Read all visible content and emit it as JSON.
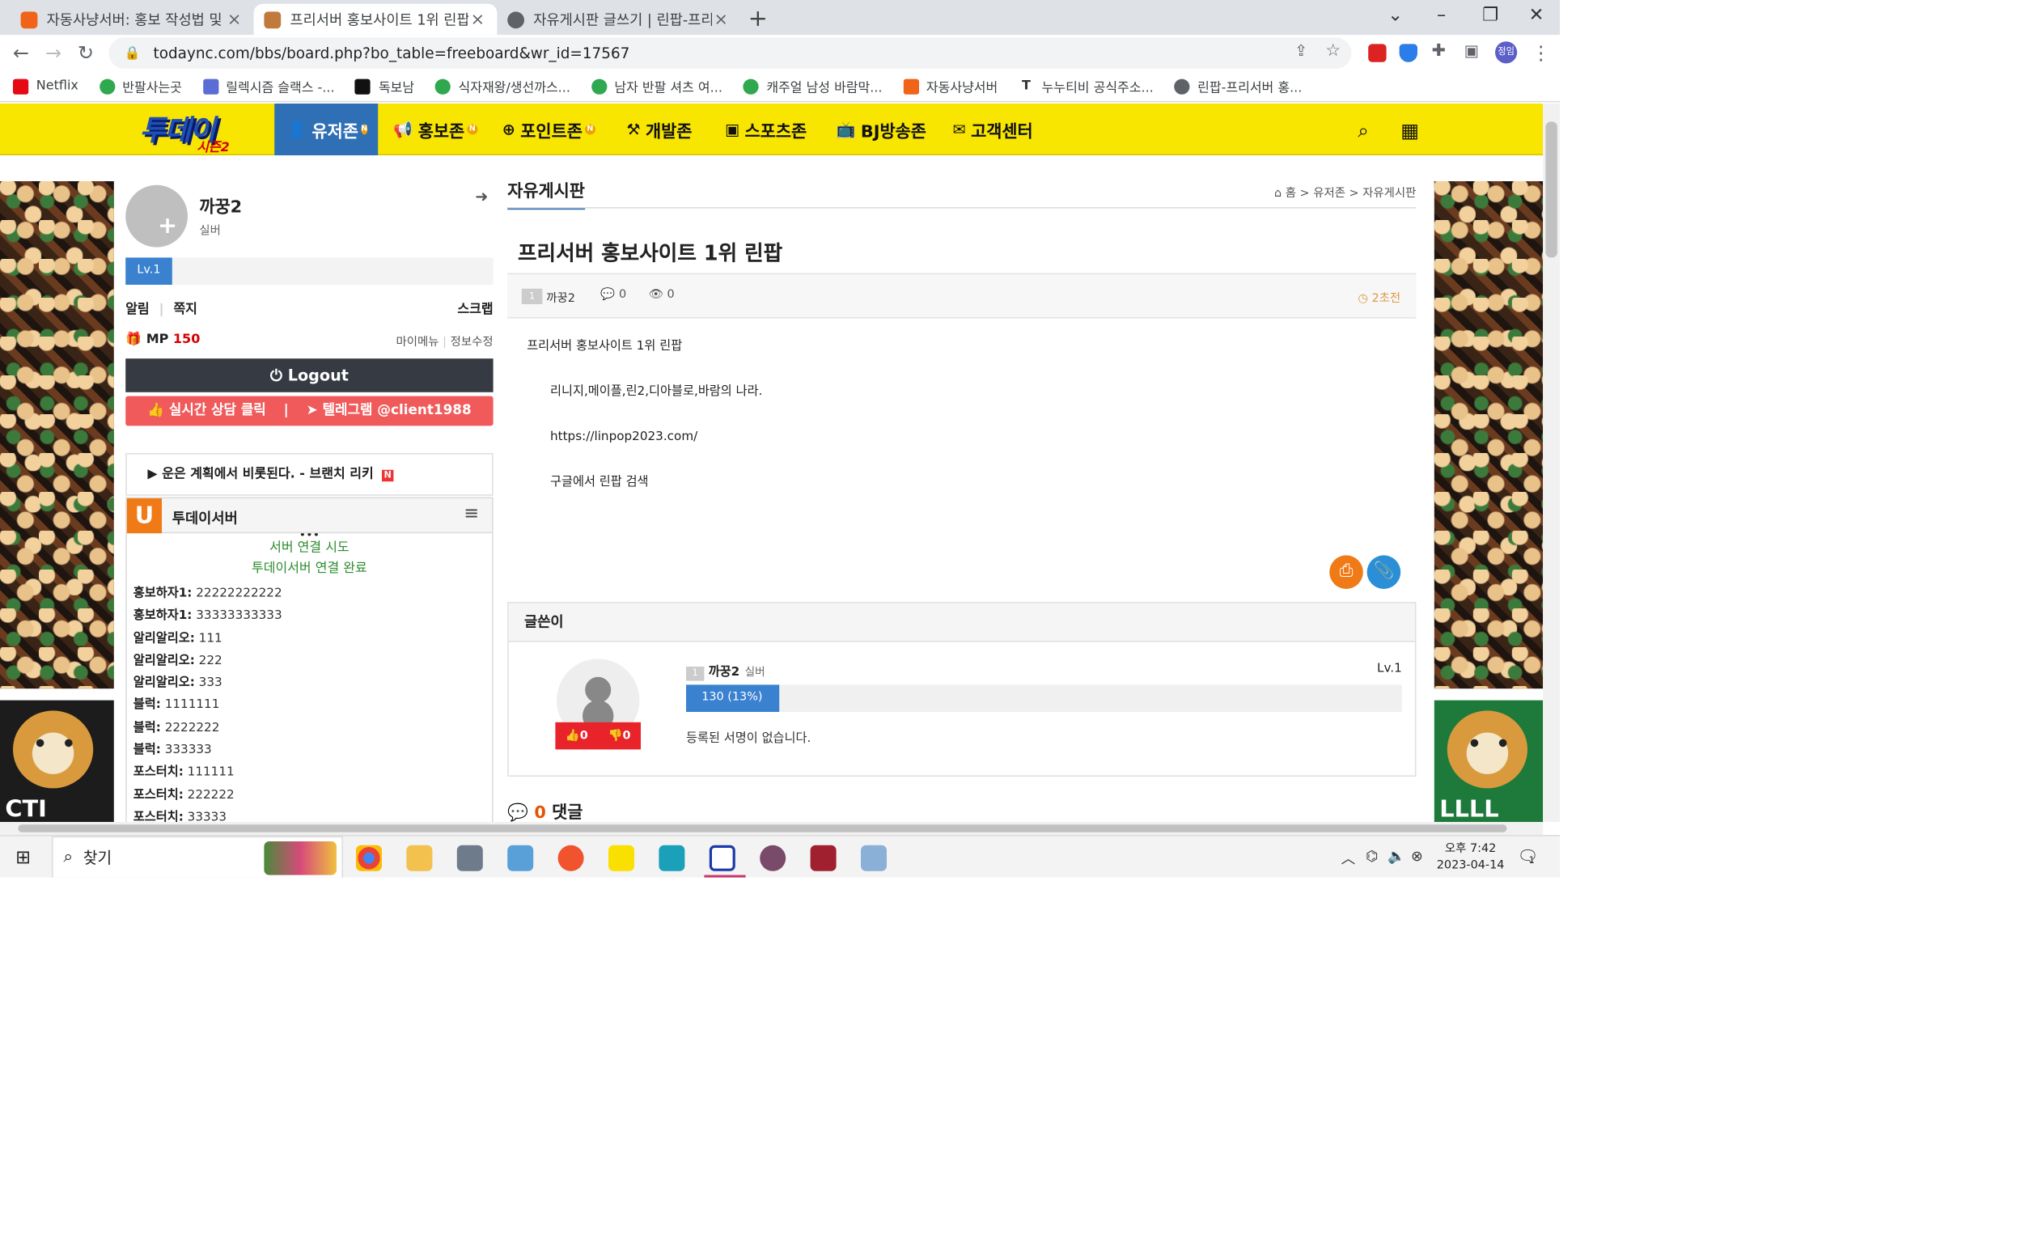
{
  "browser": {
    "tabs": [
      {
        "title": "자동사냥서버: 홍보 작성법 및 U",
        "active": false,
        "favicon_color": "#f0641a"
      },
      {
        "title": "프리서버 홍보사이트 1위 린팝",
        "active": true,
        "favicon_color": "#c07a3c"
      },
      {
        "title": "자유게시판 글쓰기 | 린팝-프리서",
        "active": false,
        "favicon_color": "#5f6368"
      }
    ],
    "new_tab_label": "+",
    "url": "todaync.com/bbs/board.php?bo_table=freeboard&wr_id=17567",
    "profile_label": "정임",
    "bookmarks": [
      {
        "label": "Netflix",
        "color": "#e50914"
      },
      {
        "label": "반팔사는곳",
        "color": "#2fa84f"
      },
      {
        "label": "릴렉시즘 슬랙스 -...",
        "color": "#5b6cd6"
      },
      {
        "label": "독보남",
        "color": "#111111"
      },
      {
        "label": "식자재왕/생선까스...",
        "color": "#2fa84f"
      },
      {
        "label": "남자 반팔 셔츠 여...",
        "color": "#2fa84f"
      },
      {
        "label": "캐주얼 남성 바람막...",
        "color": "#2fa84f"
      },
      {
        "label": "자동사냥서버",
        "color": "#f0641a"
      },
      {
        "label": "누누티비 공식주소...",
        "color": "#333333"
      },
      {
        "label": "린팝-프리서버 홍...",
        "color": "#5f6368"
      }
    ]
  },
  "site": {
    "logo_main": "투데이",
    "logo_sub": "시즌2",
    "menu": [
      {
        "label": "유저존",
        "icon": "user-icon",
        "active": true,
        "has_new": true
      },
      {
        "label": "홍보존",
        "icon": "bullhorn-icon",
        "active": false,
        "has_new": true
      },
      {
        "label": "포인트존",
        "icon": "coin-icon",
        "active": false,
        "has_new": true
      },
      {
        "label": "개발존",
        "icon": "wrench-icon",
        "active": false,
        "has_new": false
      },
      {
        "label": "스포츠존",
        "icon": "ball-icon",
        "active": false,
        "has_new": false
      },
      {
        "label": "BJ방송존",
        "icon": "tv-icon",
        "active": false,
        "has_new": false
      },
      {
        "label": "고객센터",
        "icon": "mail-icon",
        "active": false,
        "has_new": false
      }
    ],
    "new_badge": "N"
  },
  "profile": {
    "name": "까꿍2",
    "grade": "실버",
    "level": "Lv.1",
    "quick_left": "알림",
    "quick_mid": "쪽지",
    "quick_right": "스크랩",
    "mp_label": "MP",
    "mp_value": "150",
    "link_mymenu": "마이메뉴",
    "link_edit": "정보수정",
    "logout_label": "Logout",
    "consult_label": "실시간 상담 클릭",
    "telegram_label": "텔레그램 @client1988"
  },
  "quote": {
    "text": "운은 계획에서 비롯된다. - 브랜치 리키",
    "badge": "N"
  },
  "chat": {
    "title": "투데이서버",
    "logo_letter": "U",
    "status1": "서버 연결 시도",
    "status2": "투데이서버 연결 완료",
    "messages": [
      {
        "user": "홍보하자1:",
        "text": "22222222222"
      },
      {
        "user": "홍보하자1:",
        "text": "33333333333"
      },
      {
        "user": "알리알리오:",
        "text": "111"
      },
      {
        "user": "알리알리오:",
        "text": "222"
      },
      {
        "user": "알리알리오:",
        "text": "333"
      },
      {
        "user": "블럭:",
        "text": "1111111"
      },
      {
        "user": "블럭:",
        "text": "2222222"
      },
      {
        "user": "블럭:",
        "text": "333333"
      },
      {
        "user": "포스터치:",
        "text": "111111"
      },
      {
        "user": "포스터치:",
        "text": "222222"
      },
      {
        "user": "포스터치:",
        "text": "33333"
      }
    ]
  },
  "board": {
    "title": "자유게시판",
    "breadcrumb": "홈 > 유저존 > 자유게시판",
    "post_title": "프리서버 홍보사이트 1위 린팝",
    "level_tag": "1",
    "author": "까꿍2",
    "comment_count": "0",
    "view_count": "0",
    "time": "2초전",
    "body": [
      "프리서버 홍보사이트 1위 린팝",
      "리니지,메이플,린2,디아블로,바람의 나라.",
      "https://linpop2023.com/",
      "구글에서 린팝 검색"
    ],
    "author_box_title": "글쓴이",
    "author_grade": "실버",
    "author_level": "Lv.1",
    "likes": "0",
    "dislikes": "0",
    "exp_label": "130 (13%)",
    "exp_percent": 13,
    "signature": "등록된 서명이 없습니다.",
    "comments_count": "0",
    "comments_label": "댓글"
  },
  "banners": {
    "doge_caption_left": "CTI",
    "doge_caption_right": "LLLL"
  },
  "taskbar": {
    "search_label": "찾기",
    "clock_time": "오후 7:42",
    "clock_date": "2023-04-14",
    "notify_count": "1"
  }
}
